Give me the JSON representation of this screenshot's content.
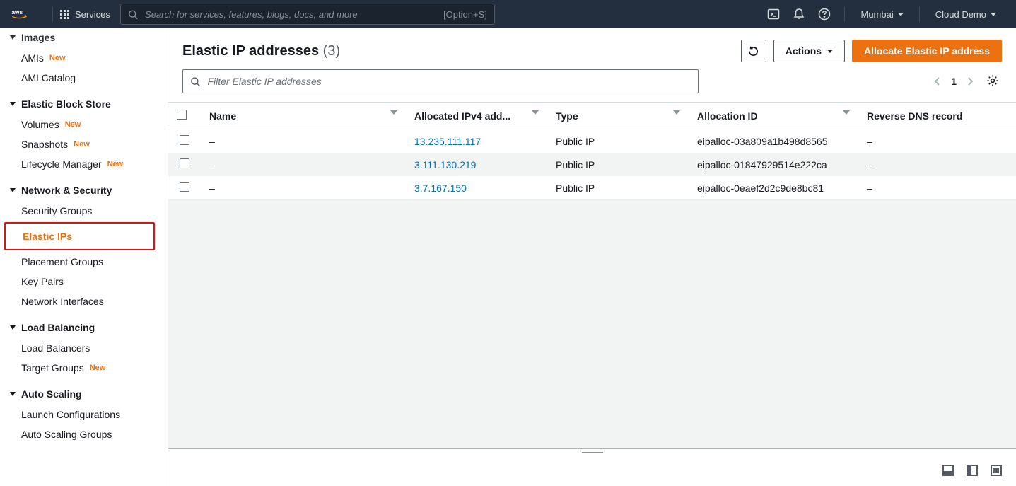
{
  "topnav": {
    "services": "Services",
    "search_placeholder": "Search for services, features, blogs, docs, and more",
    "shortcut": "[Option+S]",
    "region": "Mumbai",
    "account": "Cloud Demo"
  },
  "sidebar": {
    "images": {
      "title": "Images",
      "items": [
        {
          "label": "AMIs",
          "new": true
        },
        {
          "label": "AMI Catalog",
          "new": false
        }
      ]
    },
    "ebs": {
      "title": "Elastic Block Store",
      "items": [
        {
          "label": "Volumes",
          "new": true
        },
        {
          "label": "Snapshots",
          "new": true
        },
        {
          "label": "Lifecycle Manager",
          "new": true
        }
      ]
    },
    "netsec": {
      "title": "Network & Security",
      "items": [
        {
          "label": "Security Groups"
        },
        {
          "label": "Elastic IPs",
          "selected": true
        },
        {
          "label": "Placement Groups"
        },
        {
          "label": "Key Pairs"
        },
        {
          "label": "Network Interfaces"
        }
      ]
    },
    "lb": {
      "title": "Load Balancing",
      "items": [
        {
          "label": "Load Balancers"
        },
        {
          "label": "Target Groups",
          "new": true
        }
      ]
    },
    "as": {
      "title": "Auto Scaling",
      "items": [
        {
          "label": "Launch Configurations"
        },
        {
          "label": "Auto Scaling Groups"
        }
      ]
    },
    "new_badge": "New"
  },
  "page": {
    "title": "Elastic IP addresses",
    "count": "(3)",
    "actions_label": "Actions",
    "allocate_label": "Allocate Elastic IP address",
    "filter_placeholder": "Filter Elastic IP addresses",
    "page_number": "1"
  },
  "table": {
    "headers": {
      "name": "Name",
      "ip": "Allocated IPv4 add...",
      "type": "Type",
      "alloc": "Allocation ID",
      "rdns": "Reverse DNS record"
    },
    "rows": [
      {
        "name": "–",
        "ip": "13.235.111.117",
        "type": "Public IP",
        "alloc": "eipalloc-03a809a1b498d8565",
        "rdns": "–"
      },
      {
        "name": "–",
        "ip": "3.111.130.219",
        "type": "Public IP",
        "alloc": "eipalloc-01847929514e222ca",
        "rdns": "–"
      },
      {
        "name": "–",
        "ip": "3.7.167.150",
        "type": "Public IP",
        "alloc": "eipalloc-0eaef2d2c9de8bc81",
        "rdns": "–"
      }
    ]
  }
}
